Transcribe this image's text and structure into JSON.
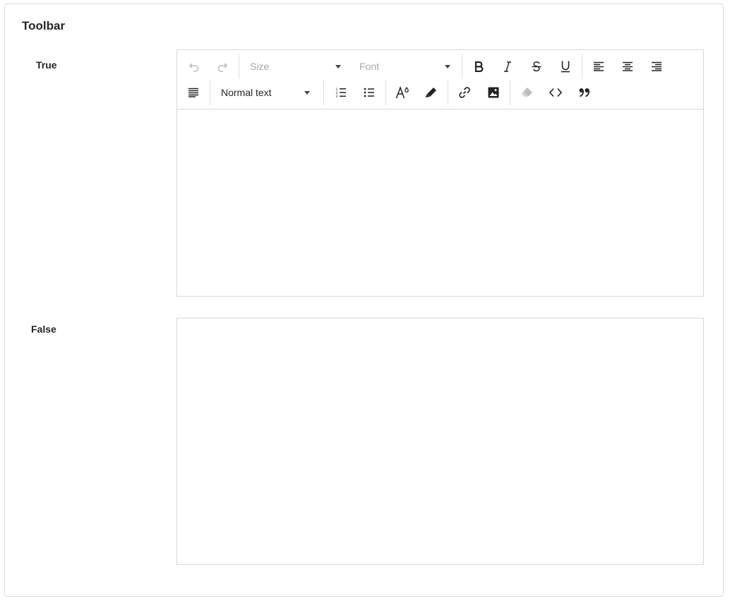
{
  "card": {
    "title": "Toolbar"
  },
  "sections": {
    "true": {
      "label": "True"
    },
    "false": {
      "label": "False"
    }
  },
  "toolbar": {
    "undo_icon": "undo-icon",
    "redo_icon": "redo-icon",
    "size_select": {
      "placeholder": "Size"
    },
    "font_select": {
      "placeholder": "Font"
    },
    "format_select": {
      "value": "Normal text"
    },
    "buttons": [
      "bold",
      "italic",
      "strikethrough",
      "underline",
      "align-left",
      "align-center",
      "align-right",
      "align-justify",
      "ordered-list",
      "unordered-list",
      "font-color",
      "highlight",
      "link",
      "image",
      "clear-format",
      "code",
      "quote"
    ],
    "colors": {
      "icon": "#222222",
      "disabled": "#bdbdbd",
      "border": "#d9d9d9"
    }
  }
}
